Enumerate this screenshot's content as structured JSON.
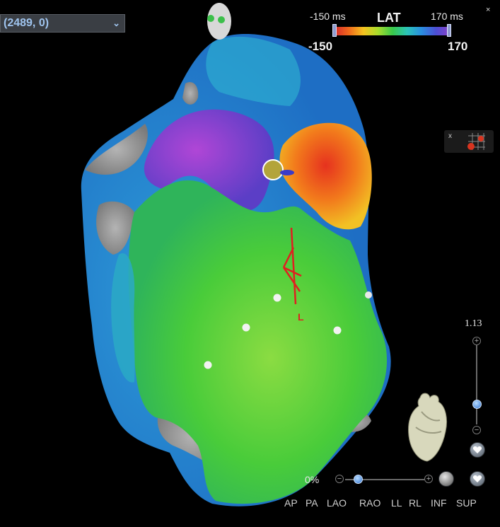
{
  "map_selector": {
    "value": "(2489, 0)"
  },
  "lat_legend": {
    "title": "LAT",
    "left_unit_label": "-150 ms",
    "right_unit_label": "170 ms",
    "min_value": "-150",
    "max_value": "170"
  },
  "corner_close": "×",
  "mini_panel_close": "x",
  "map_marker_label": "L",
  "zoom": {
    "value": "1.13",
    "level_fraction": 0.62
  },
  "opacity": {
    "value": "0%",
    "level_fraction": 0.17
  },
  "view_buttons": [
    "AP",
    "PA",
    "LAO",
    "RAO",
    "LL",
    "RL",
    "INF",
    "SUP"
  ],
  "icons": {
    "zoom_in": "plus-icon",
    "zoom_out": "minus-icon",
    "heart_orientation": "heart-3d-icon",
    "heart_button": "heart-icon",
    "transparency_button": "sphere-icon",
    "heart_view_button": "heart-target-icon"
  },
  "colors": {
    "background": "#000000",
    "lat_min": "#d8282a",
    "lat_max": "#8a3fc8",
    "selector_text": "#9fc4ee"
  }
}
